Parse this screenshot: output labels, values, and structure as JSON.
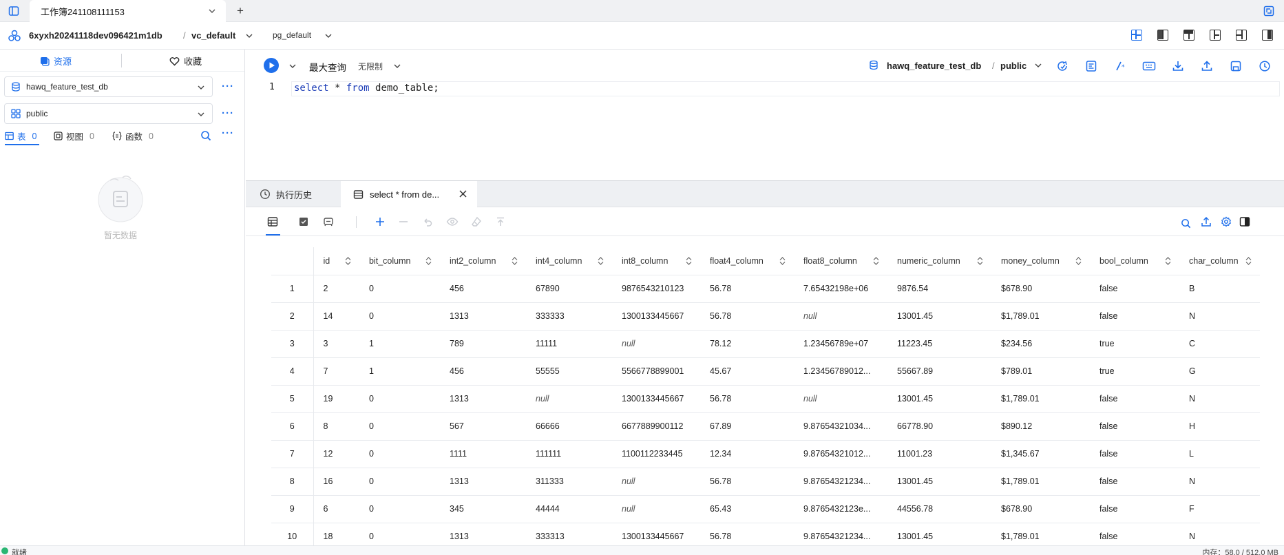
{
  "titlebar": {
    "workbook_tab": "工作簿241108111153",
    "add_tab": "+"
  },
  "header": {
    "project": "6xyxh20241118dev096421m1db",
    "separator": "/",
    "vc": "vc_default",
    "pg": "pg_default"
  },
  "left": {
    "tab_resources": "资源",
    "tab_favorites": "收藏",
    "database": "hawq_feature_test_db",
    "schema": "public",
    "more": "···",
    "obj_tabs": [
      {
        "label": "表",
        "count": "0"
      },
      {
        "label": "视图",
        "count": "0"
      },
      {
        "label": "函数",
        "count": "0"
      }
    ],
    "empty_text": "暂无数据"
  },
  "editor": {
    "max_query": "最大查询",
    "limit": "无限制",
    "db": "hawq_feature_test_db",
    "sep": "/",
    "schema": "public",
    "line_number": "1",
    "code_select": "select",
    "code_star": " * ",
    "code_from": "from",
    "code_rest": " demo_table;"
  },
  "results": {
    "tab_history": "执行历史",
    "tab_result": "select * from de...",
    "columns": [
      "id",
      "bit_column",
      "int2_column",
      "int4_column",
      "int8_column",
      "float4_column",
      "float8_column",
      "numeric_column",
      "money_column",
      "bool_column",
      "char_column"
    ],
    "rows": [
      [
        "1",
        "2",
        "0",
        "456",
        "67890",
        "9876543210123",
        "56.78",
        "7.65432198e+06",
        "9876.54",
        "$678.90",
        "false",
        "B"
      ],
      [
        "2",
        "14",
        "0",
        "1313",
        "333333",
        "1300133445667",
        "56.78",
        "null",
        "13001.45",
        "$1,789.01",
        "false",
        "N"
      ],
      [
        "3",
        "3",
        "1",
        "789",
        "11111",
        "null",
        "78.12",
        "1.23456789e+07",
        "11223.45",
        "$234.56",
        "true",
        "C"
      ],
      [
        "4",
        "7",
        "1",
        "456",
        "55555",
        "5566778899001",
        "45.67",
        "1.23456789012...",
        "55667.89",
        "$789.01",
        "true",
        "G"
      ],
      [
        "5",
        "19",
        "0",
        "1313",
        "null",
        "1300133445667",
        "56.78",
        "null",
        "13001.45",
        "$1,789.01",
        "false",
        "N"
      ],
      [
        "6",
        "8",
        "0",
        "567",
        "66666",
        "6677889900112",
        "67.89",
        "9.87654321034...",
        "66778.90",
        "$890.12",
        "false",
        "H"
      ],
      [
        "7",
        "12",
        "0",
        "1111",
        "111111",
        "1100112233445",
        "12.34",
        "9.87654321012...",
        "11001.23",
        "$1,345.67",
        "false",
        "L"
      ],
      [
        "8",
        "16",
        "0",
        "1313",
        "311333",
        "null",
        "56.78",
        "9.87654321234...",
        "13001.45",
        "$1,789.01",
        "false",
        "N"
      ],
      [
        "9",
        "6",
        "0",
        "345",
        "44444",
        "null",
        "65.43",
        "9.8765432123e...",
        "44556.78",
        "$678.90",
        "false",
        "F"
      ],
      [
        "10",
        "18",
        "0",
        "1313",
        "333313",
        "1300133445667",
        "56.78",
        "9.87654321234...",
        "13001.45",
        "$1,789.01",
        "false",
        "N"
      ]
    ]
  },
  "status": {
    "text": "就绪",
    "memory": "内存：58.0 / 512.0 MB"
  },
  "colors": {
    "accent": "#1f6feb",
    "ready": "#2bb673"
  }
}
